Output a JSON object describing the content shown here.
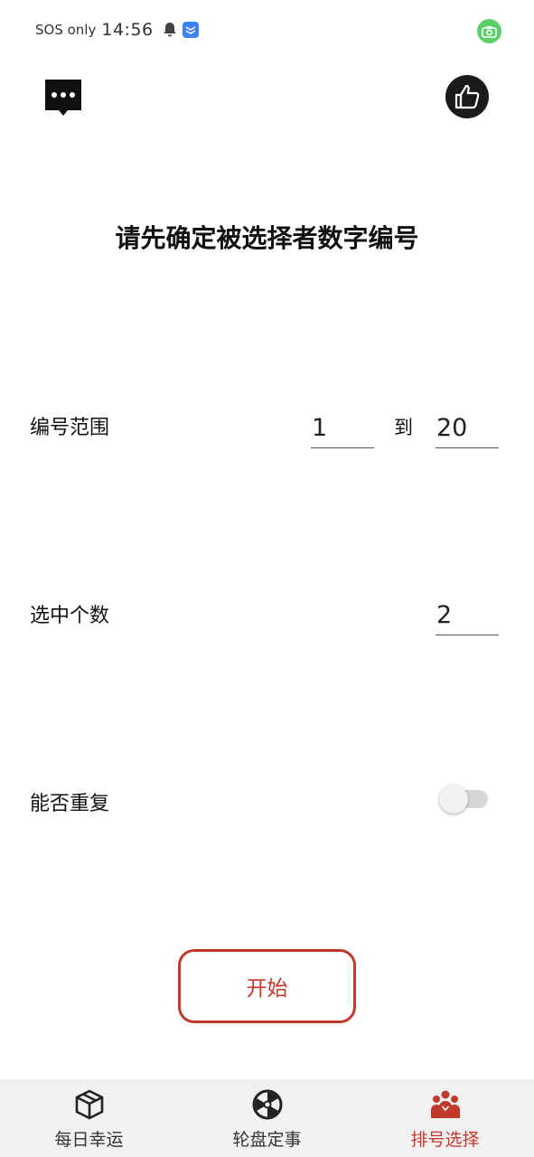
{
  "status_bar": {
    "carrier": "SOS only",
    "time": "14:56"
  },
  "title": "请先确定被选择者数字编号",
  "range": {
    "label": "编号范围",
    "from_value": "1",
    "to_label": "到",
    "to_value": "20"
  },
  "count": {
    "label": "选中个数",
    "value": "2"
  },
  "repeat": {
    "label": "能否重复",
    "enabled": false
  },
  "start_button": "开始",
  "bottom_nav": {
    "items": [
      {
        "label": "每日幸运",
        "icon": "box-icon",
        "active": false
      },
      {
        "label": "轮盘定事",
        "icon": "wheel-icon",
        "active": false
      },
      {
        "label": "排号选择",
        "icon": "group-icon",
        "active": true
      }
    ]
  },
  "colors": {
    "accent": "#c0392b",
    "nav_background": "#f1f1f1",
    "camera_indicator": "#5ccf6a"
  }
}
